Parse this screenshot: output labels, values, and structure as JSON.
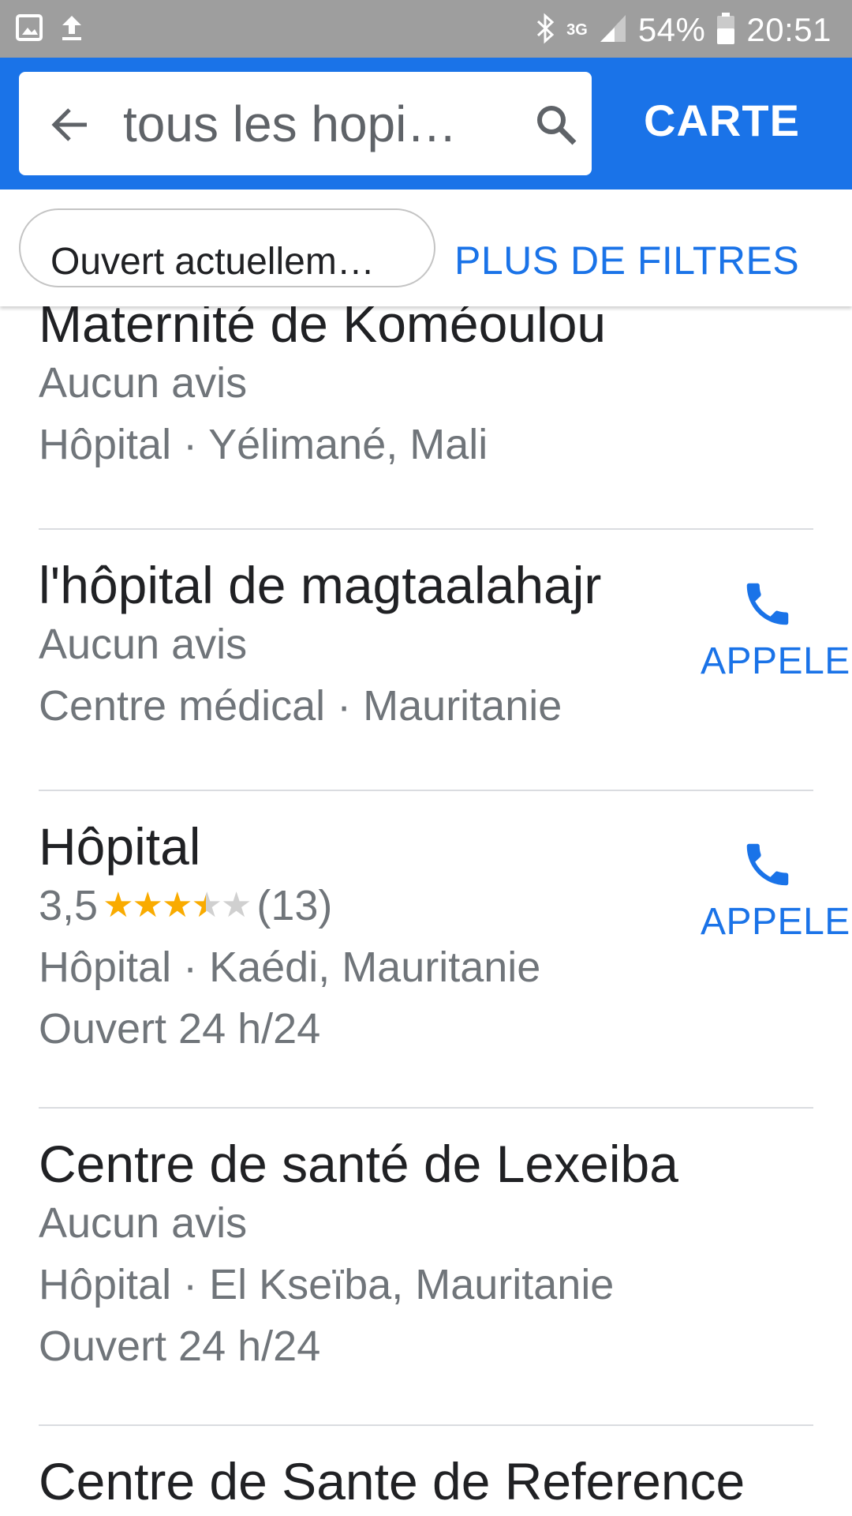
{
  "status_bar": {
    "network": "3G",
    "battery": "54%",
    "time": "20:51"
  },
  "header": {
    "search_query": "tous les hopi…",
    "map_button": "CARTE"
  },
  "filters": {
    "chip_label": "Ouvert actuellem…",
    "more_filters": "PLUS DE FILTRES"
  },
  "results": [
    {
      "name": "Maternité de Koméoulou",
      "reviews": "Aucun avis",
      "category_location": "Hôpital · Yélimané, Mali"
    },
    {
      "name": "l'hôpital de magtaalahajr",
      "reviews": "Aucun avis",
      "category_location": "Centre médical · Mauritanie",
      "action": "APPELER"
    },
    {
      "name": "Hôpital",
      "rating": "3,5",
      "rating_value": 3.5,
      "review_count": "(13)",
      "category_location": "Hôpital · Kaédi, Mauritanie",
      "hours": "Ouvert 24 h/24",
      "action": "APPELER"
    },
    {
      "name": "Centre de santé de Lexeiba",
      "reviews": "Aucun avis",
      "category_location": "Hôpital · El Kseïba, Mauritanie",
      "hours": "Ouvert 24 h/24"
    },
    {
      "name": "Centre de Sante de Reference"
    }
  ],
  "colors": {
    "accent": "#1a73e8",
    "status_bar": "#9e9e9e",
    "star": "#f9ab00"
  },
  "icons": [
    "image-icon",
    "upload-icon",
    "bluetooth-icon",
    "signal-icon",
    "battery-icon",
    "back-arrow-icon",
    "search-icon",
    "phone-icon"
  ]
}
